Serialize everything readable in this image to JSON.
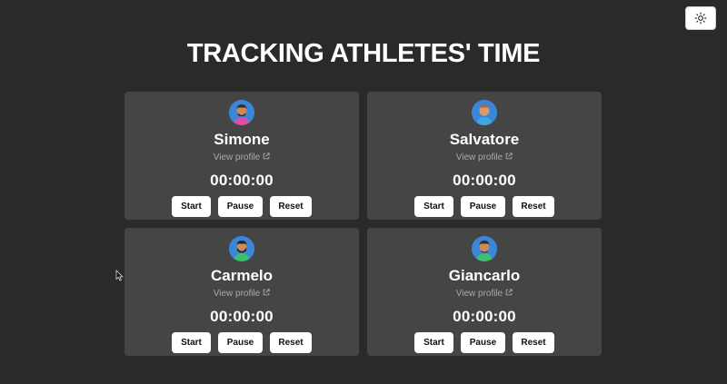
{
  "header": {
    "title": "TRACKING ATHLETES' TIME",
    "theme_toggle_icon": "sun-icon"
  },
  "athletes": [
    {
      "name": "Simone",
      "profile_link": "View profile",
      "time": "00:00:00",
      "avatar_color": "#3a86d9",
      "shirt_color": "#d94fa8",
      "buttons": {
        "start": "Start",
        "pause": "Pause",
        "reset": "Reset"
      }
    },
    {
      "name": "Salvatore",
      "profile_link": "View profile",
      "time": "00:00:00",
      "avatar_color": "#3a86d9",
      "shirt_color": "#3fa7e0",
      "buttons": {
        "start": "Start",
        "pause": "Pause",
        "reset": "Reset"
      }
    },
    {
      "name": "Carmelo",
      "profile_link": "View profile",
      "time": "00:00:00",
      "avatar_color": "#3a86d9",
      "shirt_color": "#3fbf6a",
      "buttons": {
        "start": "Start",
        "pause": "Pause",
        "reset": "Reset"
      }
    },
    {
      "name": "Giancarlo",
      "profile_link": "View profile",
      "time": "00:00:00",
      "avatar_color": "#3a86d9",
      "shirt_color": "#3fbf6a",
      "buttons": {
        "start": "Start",
        "pause": "Pause",
        "reset": "Reset"
      }
    }
  ],
  "colors": {
    "background": "#2b2a2a",
    "card": "#454545",
    "muted_text": "#a9a9a9",
    "button_bg": "#ffffff"
  }
}
